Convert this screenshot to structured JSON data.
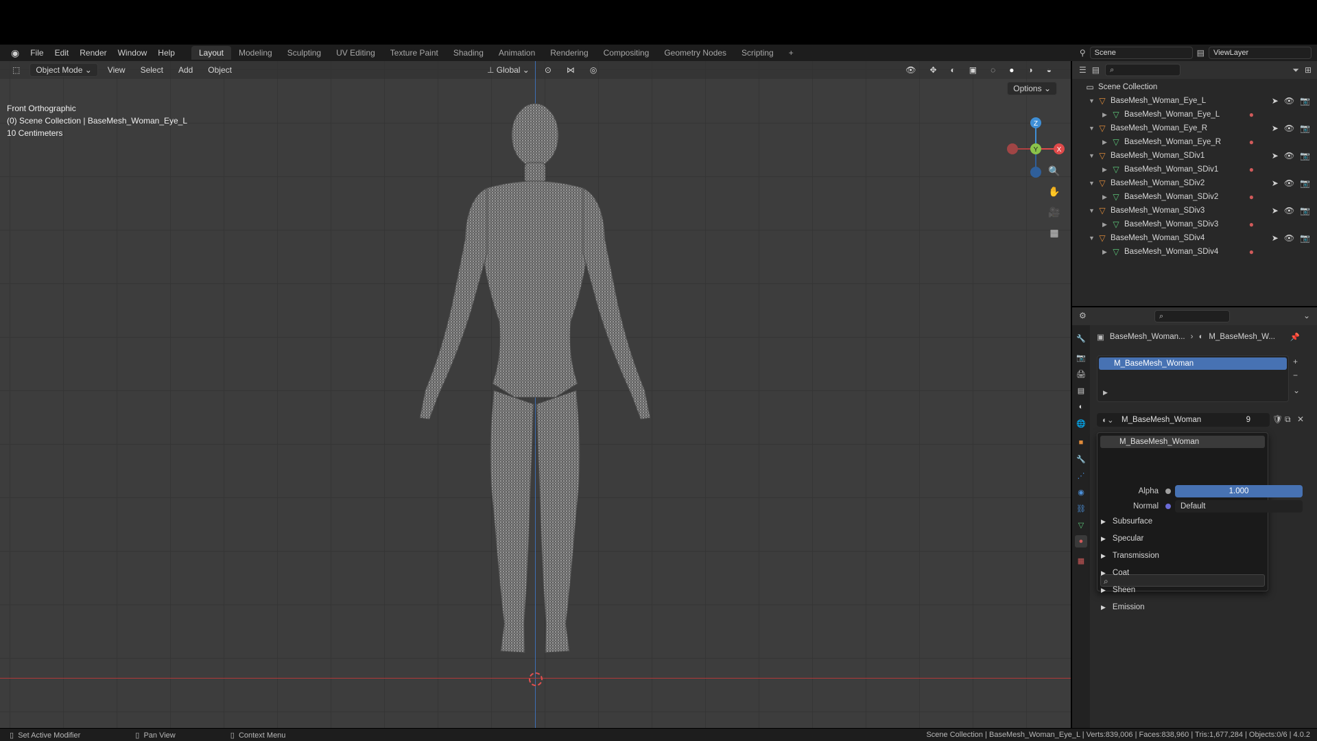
{
  "menu": [
    "File",
    "Edit",
    "Render",
    "Window",
    "Help"
  ],
  "workspace_tabs": [
    {
      "label": "Layout",
      "active": true
    },
    {
      "label": "Modeling"
    },
    {
      "label": "Sculpting"
    },
    {
      "label": "UV Editing"
    },
    {
      "label": "Texture Paint"
    },
    {
      "label": "Shading"
    },
    {
      "label": "Animation"
    },
    {
      "label": "Rendering"
    },
    {
      "label": "Compositing"
    },
    {
      "label": "Geometry Nodes"
    },
    {
      "label": "Scripting"
    }
  ],
  "scene": "Scene",
  "view_layer": "ViewLayer",
  "viewport": {
    "mode": "Object Mode",
    "menus": [
      "View",
      "Select",
      "Add",
      "Object"
    ],
    "transform": "Global",
    "options": "Options",
    "overlay": [
      "Front Orthographic",
      "(0) Scene Collection | BaseMesh_Woman_Eye_L",
      "10 Centimeters"
    ],
    "gizmo": {
      "z": "Z",
      "y": "Y",
      "x": "X"
    }
  },
  "outliner": {
    "root": "Scene Collection",
    "items": [
      {
        "object": "BaseMesh_Woman_Eye_L",
        "mesh": "BaseMesh_Woman_Eye_L"
      },
      {
        "object": "BaseMesh_Woman_Eye_R",
        "mesh": "BaseMesh_Woman_Eye_R"
      },
      {
        "object": "BaseMesh_Woman_SDiv1",
        "mesh": "BaseMesh_Woman_SDiv1"
      },
      {
        "object": "BaseMesh_Woman_SDiv2",
        "mesh": "BaseMesh_Woman_SDiv2"
      },
      {
        "object": "BaseMesh_Woman_SDiv3",
        "mesh": "BaseMesh_Woman_SDiv3"
      },
      {
        "object": "BaseMesh_Woman_SDiv4",
        "mesh": "BaseMesh_Woman_SDiv4"
      }
    ]
  },
  "properties": {
    "breadcrumb_object": "BaseMesh_Woman...",
    "breadcrumb_material": "M_BaseMesh_W...",
    "material_slot": "M_BaseMesh_Woman",
    "datablock": "M_BaseMesh_Woman",
    "users": "9",
    "dropdown_item": "M_BaseMesh_Woman",
    "alpha_label": "Alpha",
    "alpha_value": "1.000",
    "normal_label": "Normal",
    "normal_value": "Default",
    "sections": [
      "Subsurface",
      "Specular",
      "Transmission",
      "Coat",
      "Sheen",
      "Emission"
    ]
  },
  "statusbar": {
    "left": [
      "Set Active Modifier",
      "Pan View",
      "Context Menu"
    ],
    "right": "Scene Collection | BaseMesh_Woman_Eye_L | Verts:839,006 | Faces:838,960 | Tris:1,677,284 | Objects:0/6 | 4.0.2"
  },
  "colors": {
    "accent": "#4772b3",
    "axis_x": "#e04a4a",
    "axis_y": "#8bc34a",
    "axis_z": "#3f8fd6"
  }
}
